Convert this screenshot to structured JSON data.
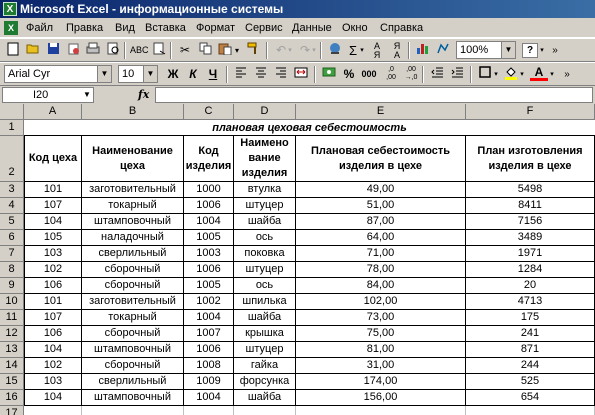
{
  "window": {
    "title": "Microsoft Excel - информационные системы"
  },
  "menu": [
    "Файл",
    "Правка",
    "Вид",
    "Вставка",
    "Формат",
    "Сервис",
    "Данные",
    "Окно",
    "Справка"
  ],
  "toolbar": {
    "zoom": "100%",
    "font": "Arial Cyr",
    "size": "10",
    "bold": "Ж",
    "italic": "К",
    "underline": "Ч",
    "percent": "%",
    "thousands": "000"
  },
  "formula_bar": {
    "name_box": "I20",
    "fx": "fx",
    "content": ""
  },
  "columns": [
    "A",
    "B",
    "C",
    "D",
    "E",
    "F"
  ],
  "rows": [
    "1",
    "2",
    "3",
    "4",
    "5",
    "6",
    "7",
    "8",
    "9",
    "10",
    "11",
    "12",
    "13",
    "14",
    "15",
    "16",
    "17"
  ],
  "sheet": {
    "title": "плановая цеховая себестоимость",
    "headers": [
      "Код цеха",
      "Наименование цеха",
      "Код изделия",
      "Наимено вание изделия",
      "Плановая себестоимость изделия в цехе",
      "План изготовления изделия в цехе"
    ],
    "data": [
      [
        "101",
        "заготовительный",
        "1000",
        "втулка",
        "49,00",
        "5498"
      ],
      [
        "107",
        "токарный",
        "1006",
        "штуцер",
        "51,00",
        "8411"
      ],
      [
        "104",
        "штамповочный",
        "1004",
        "шайба",
        "87,00",
        "7156"
      ],
      [
        "105",
        "наладочный",
        "1005",
        "ось",
        "64,00",
        "3489"
      ],
      [
        "103",
        "сверлильный",
        "1003",
        "поковка",
        "71,00",
        "1971"
      ],
      [
        "102",
        "сборочный",
        "1006",
        "штуцер",
        "78,00",
        "1284"
      ],
      [
        "106",
        "сборочный",
        "1005",
        "ось",
        "84,00",
        "20"
      ],
      [
        "101",
        "заготовительный",
        "1002",
        "шпилька",
        "102,00",
        "4713"
      ],
      [
        "107",
        "токарный",
        "1004",
        "шайба",
        "73,00",
        "175"
      ],
      [
        "106",
        "сборочный",
        "1007",
        "крышка",
        "75,00",
        "241"
      ],
      [
        "104",
        "штамповочный",
        "1006",
        "штуцер",
        "81,00",
        "871"
      ],
      [
        "102",
        "сборочный",
        "1008",
        "гайка",
        "31,00",
        "244"
      ],
      [
        "103",
        "сверлильный",
        "1009",
        "форсунка",
        "174,00",
        "525"
      ],
      [
        "104",
        "штамповочный",
        "1004",
        "шайба",
        "156,00",
        "654"
      ]
    ]
  }
}
